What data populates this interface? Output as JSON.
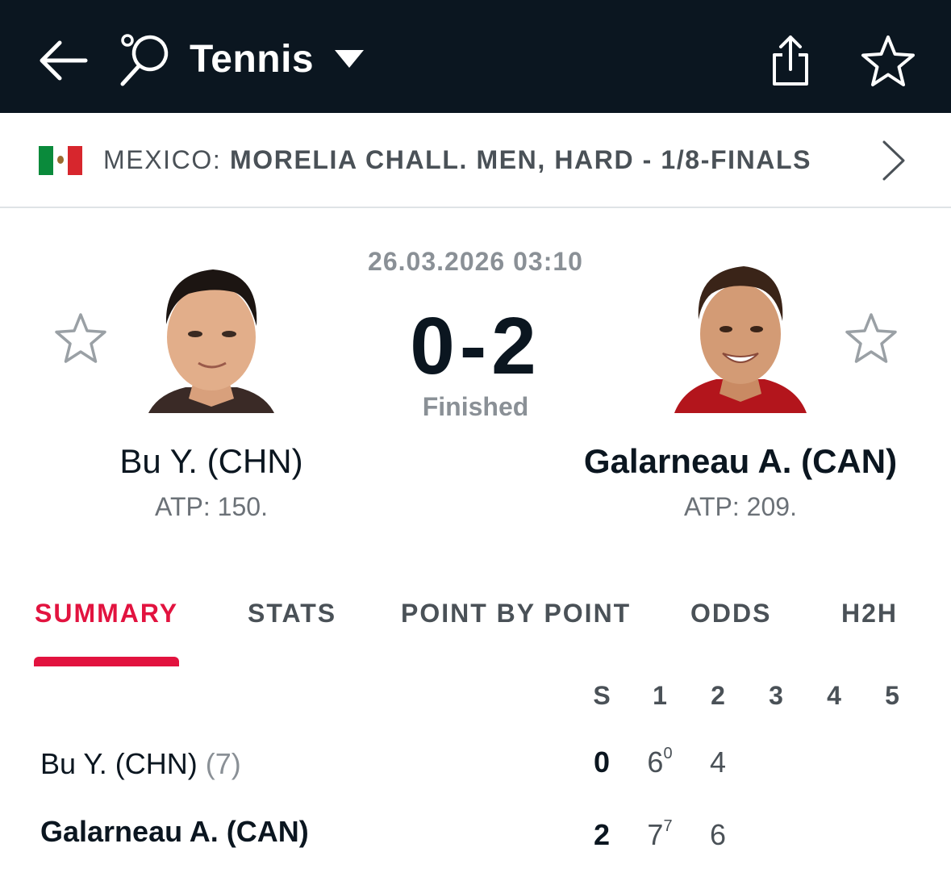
{
  "header": {
    "title": "Tennis",
    "icons": [
      "back-arrow-icon",
      "tennis-racket-icon",
      "dropdown-caret-icon",
      "share-icon",
      "star-icon"
    ]
  },
  "league": {
    "country": "MEXICO:",
    "name": "MORELIA CHALL. MEN, HARD - 1/8-FINALS",
    "flag": "mexico-flag"
  },
  "match": {
    "datetime": "26.03.2026 03:10",
    "score": "0-2",
    "status": "Finished",
    "home": {
      "name": "Bu Y. (CHN)",
      "rank": "ATP: 150."
    },
    "away": {
      "name": "Galarneau A. (CAN)",
      "rank": "ATP: 209."
    }
  },
  "tabs": [
    "SUMMARY",
    "STATS",
    "POINT BY POINT",
    "ODDS",
    "H2H"
  ],
  "active_tab": "SUMMARY",
  "scoreboard": {
    "headers": [
      "S",
      "1",
      "2",
      "3",
      "4",
      "5"
    ],
    "rows": [
      {
        "name": "Bu Y. (CHN)",
        "seed": "(7)",
        "sets": "0",
        "set1": "6",
        "set1_tb": "0",
        "set2": "4"
      },
      {
        "name": "Galarneau A. (CAN)",
        "seed": "",
        "sets": "2",
        "set1": "7",
        "set1_tb": "7",
        "set2": "6"
      }
    ]
  },
  "colors": {
    "topbar": "#0b1620",
    "accent": "#e2133f",
    "muted": "#8a9096"
  }
}
